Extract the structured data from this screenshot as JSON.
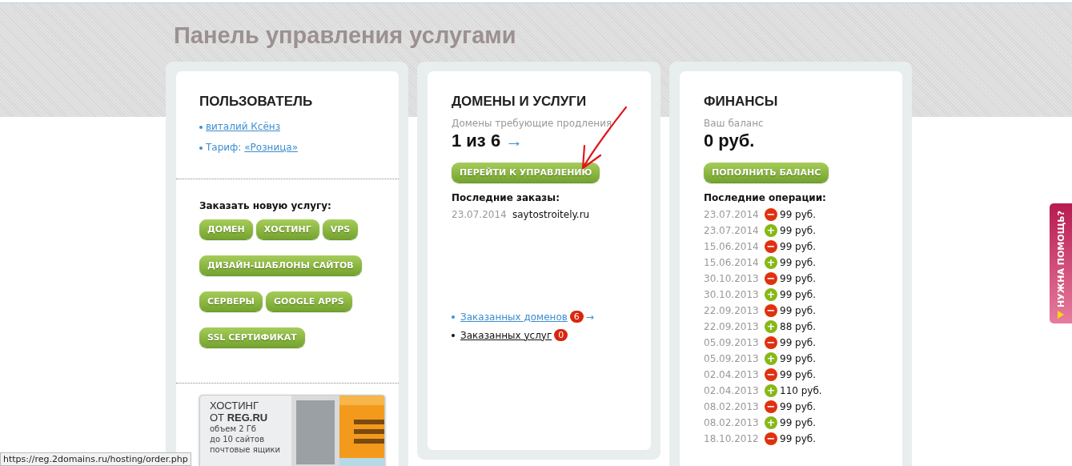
{
  "page_title": "Панель управления услугами",
  "user": {
    "heading": "ПОЛЬЗОВАТЕЛЬ",
    "name_link": "виталий Ксёнз",
    "tariff_label": "Тариф:",
    "tariff_link": "«Розница»",
    "order_heading": "Заказать новую услугу:",
    "service_buttons": [
      [
        "ДОМЕН",
        "ХОСТИНГ",
        "VPS"
      ],
      [
        "ДИЗАЙН-ШАБЛОНЫ САЙТОВ"
      ],
      [
        "СЕРВЕРЫ",
        "GOOGLE APPS"
      ],
      [
        "SSL СЕРТИФИКАТ"
      ]
    ],
    "banner": {
      "title_1": "ХОСТИНГ",
      "title_2_prefix": "ОТ",
      "title_2_brand": "REG.RU",
      "lines": [
        "объем 2 Гб",
        "до 10 сайтов",
        "почтовые ящики"
      ]
    }
  },
  "domains": {
    "heading": "ДОМЕНЫ И УСЛУГИ",
    "renew_label": "Домены требующие продления",
    "renew_count": "1 из 6",
    "arrow": "→",
    "manage_button": "ПЕРЕЙТИ К УПРАВЛЕНИЮ",
    "orders_heading": "Последние заказы:",
    "orders": [
      {
        "date": "23.07.2014",
        "domain": "saytostroitely.ru"
      }
    ],
    "links": [
      {
        "label": "Заказанных доменов",
        "count": "6",
        "arrow": "→",
        "kind": "link"
      },
      {
        "label": "Заказанных услуг",
        "count": "0",
        "kind": "plain"
      }
    ]
  },
  "finance": {
    "heading": "ФИНАНСЫ",
    "balance_label": "Ваш баланс",
    "balance": "0 руб.",
    "topup_button": "ПОПОЛНИТЬ БАЛАНС",
    "ops_heading": "Последние операции:",
    "operations": [
      {
        "date": "23.07.2014",
        "kind": "debit",
        "sign": "−",
        "amount": "99 руб."
      },
      {
        "date": "23.07.2014",
        "kind": "credit",
        "sign": "+",
        "amount": "99 руб."
      },
      {
        "date": "15.06.2014",
        "kind": "debit",
        "sign": "−",
        "amount": "99 руб."
      },
      {
        "date": "15.06.2014",
        "kind": "credit",
        "sign": "+",
        "amount": "99 руб."
      },
      {
        "date": "30.10.2013",
        "kind": "debit",
        "sign": "−",
        "amount": "99 руб."
      },
      {
        "date": "30.10.2013",
        "kind": "credit",
        "sign": "+",
        "amount": "99 руб."
      },
      {
        "date": "22.09.2013",
        "kind": "debit",
        "sign": "−",
        "amount": "99 руб."
      },
      {
        "date": "22.09.2013",
        "kind": "credit",
        "sign": "+",
        "amount": "88 руб."
      },
      {
        "date": "05.09.2013",
        "kind": "debit",
        "sign": "−",
        "amount": "99 руб."
      },
      {
        "date": "05.09.2013",
        "kind": "credit",
        "sign": "+",
        "amount": "99 руб."
      },
      {
        "date": "02.04.2013",
        "kind": "debit",
        "sign": "−",
        "amount": "99 руб."
      },
      {
        "date": "02.04.2013",
        "kind": "credit",
        "sign": "+",
        "amount": "110 руб."
      },
      {
        "date": "08.02.2013",
        "kind": "debit",
        "sign": "−",
        "amount": "99 руб."
      },
      {
        "date": "08.02.2013",
        "kind": "credit",
        "sign": "+",
        "amount": "99 руб."
      },
      {
        "date": "18.10.2012",
        "kind": "debit",
        "sign": "−",
        "amount": "99 руб."
      }
    ]
  },
  "help_tab": "НУЖНА ПОМОЩЬ?",
  "status_url": "https://reg.2domains.ru/hosting/order.php"
}
